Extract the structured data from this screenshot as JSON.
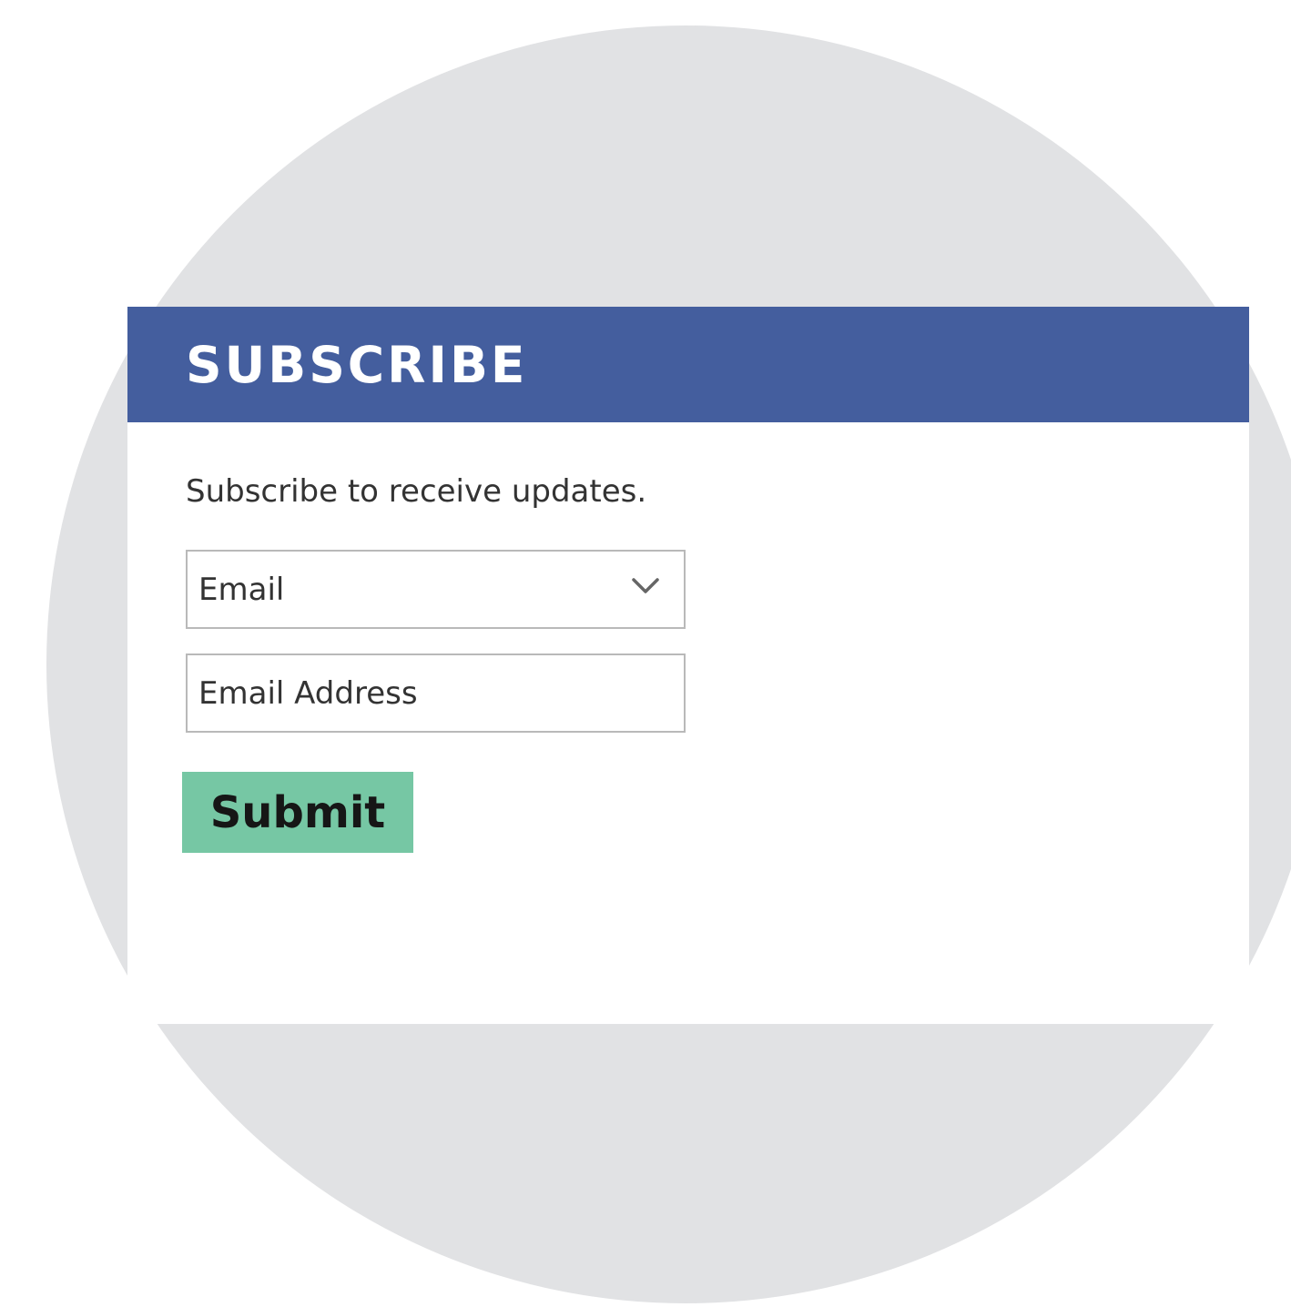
{
  "header": {
    "title": "SUBSCRIBE"
  },
  "form": {
    "intro_text": "Subscribe to receive updates.",
    "method_select": {
      "selected": "Email",
      "icon": "chevron-down-icon"
    },
    "email_input": {
      "placeholder": "Email Address"
    },
    "submit_label": "Submit"
  },
  "colors": {
    "header_bg": "#445e9e",
    "button_bg": "#76c7a4",
    "backdrop_circle": "#e1e2e4"
  }
}
